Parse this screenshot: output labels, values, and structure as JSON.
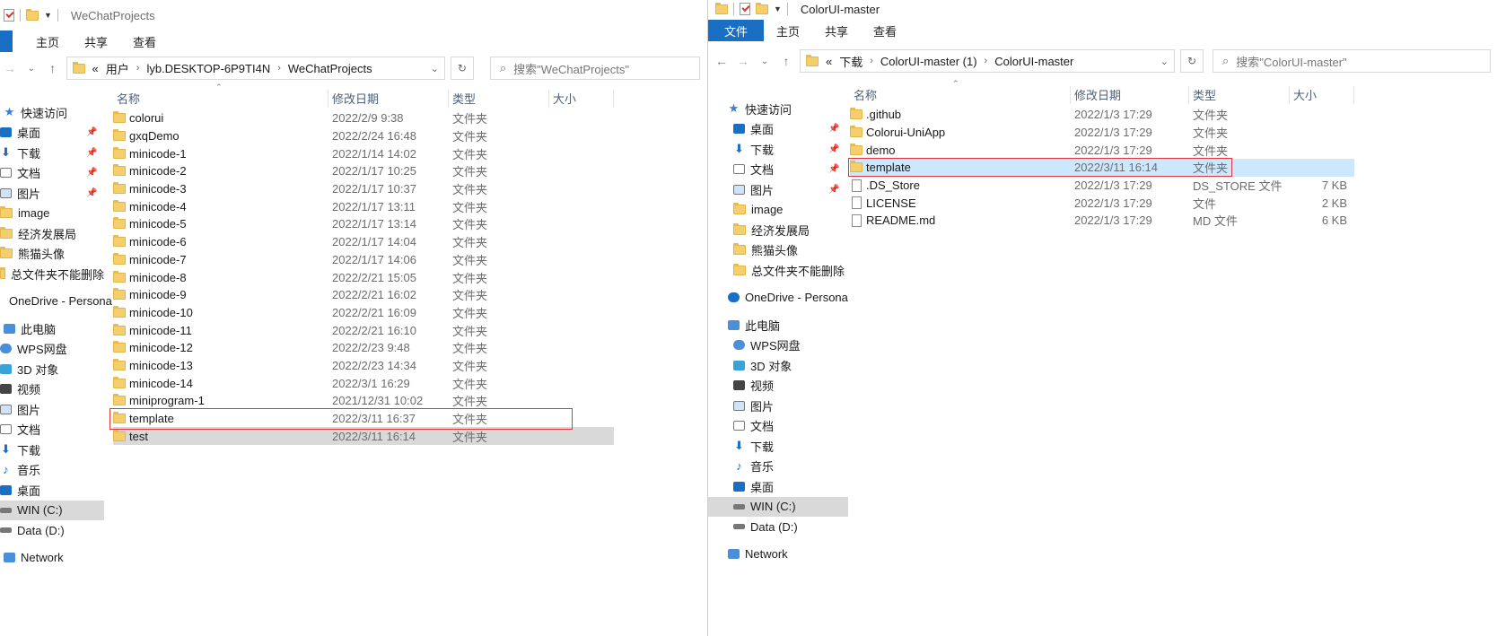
{
  "left": {
    "title": "WeChatProjects",
    "ribbon": {
      "home": "主页",
      "share": "共享",
      "view": "查看"
    },
    "breadcrumb": [
      "«",
      "用户",
      "lyb.DESKTOP-6P9TI4N",
      "WeChatProjects"
    ],
    "search_placeholder": "搜索\"WeChatProjects\"",
    "headers": {
      "name": "名称",
      "date": "修改日期",
      "type": "类型",
      "size": "大小"
    },
    "nav": [
      {
        "label": "快速访问",
        "icon": "star-icon"
      },
      {
        "label": "桌面",
        "icon": "desktop-icon",
        "pin": true
      },
      {
        "label": "下载",
        "icon": "download-icon",
        "pin": true
      },
      {
        "label": "文档",
        "icon": "document-icon",
        "pin": true
      },
      {
        "label": "图片",
        "icon": "picture-icon",
        "pin": true
      },
      {
        "label": "image",
        "icon": "folder-icon"
      },
      {
        "label": "经济发展局",
        "icon": "folder-icon"
      },
      {
        "label": "熊猫头像",
        "icon": "folder-icon"
      },
      {
        "label": "总文件夹不能删除",
        "icon": "folder-icon"
      },
      {
        "label": "OneDrive - Persona",
        "icon": "cloud-icon"
      },
      {
        "label": "此电脑",
        "icon": "computer-icon"
      },
      {
        "label": "WPS网盘",
        "icon": "wps-cloud-icon"
      },
      {
        "label": "3D 对象",
        "icon": "3d-objects-icon"
      },
      {
        "label": "视频",
        "icon": "video-icon"
      },
      {
        "label": "图片",
        "icon": "picture-icon"
      },
      {
        "label": "文档",
        "icon": "document-icon"
      },
      {
        "label": "下载",
        "icon": "download-icon"
      },
      {
        "label": "音乐",
        "icon": "music-icon"
      },
      {
        "label": "桌面",
        "icon": "desktop-icon"
      },
      {
        "label": "WIN (C:)",
        "icon": "drive-c-icon",
        "selected": true
      },
      {
        "label": "Data (D:)",
        "icon": "drive-d-icon"
      },
      {
        "label": "Network",
        "icon": "network-icon"
      }
    ],
    "files": [
      {
        "name": "colorui",
        "date": "2022/2/9 9:38",
        "type": "文件夹"
      },
      {
        "name": "gxqDemo",
        "date": "2022/2/24 16:48",
        "type": "文件夹"
      },
      {
        "name": "minicode-1",
        "date": "2022/1/14 14:02",
        "type": "文件夹"
      },
      {
        "name": "minicode-2",
        "date": "2022/1/17 10:25",
        "type": "文件夹"
      },
      {
        "name": "minicode-3",
        "date": "2022/1/17 10:37",
        "type": "文件夹"
      },
      {
        "name": "minicode-4",
        "date": "2022/1/17 13:11",
        "type": "文件夹"
      },
      {
        "name": "minicode-5",
        "date": "2022/1/17 13:14",
        "type": "文件夹"
      },
      {
        "name": "minicode-6",
        "date": "2022/1/17 14:04",
        "type": "文件夹"
      },
      {
        "name": "minicode-7",
        "date": "2022/1/17 14:06",
        "type": "文件夹"
      },
      {
        "name": "minicode-8",
        "date": "2022/2/21 15:05",
        "type": "文件夹"
      },
      {
        "name": "minicode-9",
        "date": "2022/2/21 16:02",
        "type": "文件夹"
      },
      {
        "name": "minicode-10",
        "date": "2022/2/21 16:09",
        "type": "文件夹"
      },
      {
        "name": "minicode-11",
        "date": "2022/2/21 16:10",
        "type": "文件夹"
      },
      {
        "name": "minicode-12",
        "date": "2022/2/23 9:48",
        "type": "文件夹"
      },
      {
        "name": "minicode-13",
        "date": "2022/2/23 14:34",
        "type": "文件夹"
      },
      {
        "name": "minicode-14",
        "date": "2022/3/1 16:29",
        "type": "文件夹"
      },
      {
        "name": "miniprogram-1",
        "date": "2021/12/31 10:02",
        "type": "文件夹"
      },
      {
        "name": "template",
        "date": "2022/3/11 16:37",
        "type": "文件夹",
        "boxed": true
      },
      {
        "name": "test",
        "date": "2022/3/11 16:14",
        "type": "文件夹",
        "grey": true
      }
    ]
  },
  "right": {
    "title": "ColorUI-master",
    "ribbon": {
      "file": "文件",
      "home": "主页",
      "share": "共享",
      "view": "查看"
    },
    "breadcrumb": [
      "«",
      "下载",
      "ColorUI-master (1)",
      "ColorUI-master"
    ],
    "search_placeholder": "搜索\"ColorUI-master\"",
    "headers": {
      "name": "名称",
      "date": "修改日期",
      "type": "类型",
      "size": "大小"
    },
    "nav": [
      {
        "label": "快速访问",
        "icon": "star-icon"
      },
      {
        "label": "桌面",
        "icon": "desktop-icon",
        "pin": true
      },
      {
        "label": "下载",
        "icon": "download-icon",
        "pin": true
      },
      {
        "label": "文档",
        "icon": "document-icon",
        "pin": true
      },
      {
        "label": "图片",
        "icon": "picture-icon",
        "pin": true
      },
      {
        "label": "image",
        "icon": "folder-icon"
      },
      {
        "label": "经济发展局",
        "icon": "folder-icon"
      },
      {
        "label": "熊猫头像",
        "icon": "folder-icon"
      },
      {
        "label": "总文件夹不能删除",
        "icon": "folder-icon"
      },
      {
        "label": "OneDrive - Persona",
        "icon": "cloud-icon"
      },
      {
        "label": "此电脑",
        "icon": "computer-icon"
      },
      {
        "label": "WPS网盘",
        "icon": "wps-cloud-icon"
      },
      {
        "label": "3D 对象",
        "icon": "3d-objects-icon"
      },
      {
        "label": "视频",
        "icon": "video-icon"
      },
      {
        "label": "图片",
        "icon": "picture-icon"
      },
      {
        "label": "文档",
        "icon": "document-icon"
      },
      {
        "label": "下载",
        "icon": "download-icon"
      },
      {
        "label": "音乐",
        "icon": "music-icon"
      },
      {
        "label": "桌面",
        "icon": "desktop-icon"
      },
      {
        "label": "WIN (C:)",
        "icon": "drive-c-icon",
        "selected": true
      },
      {
        "label": "Data (D:)",
        "icon": "drive-d-icon"
      },
      {
        "label": "Network",
        "icon": "network-icon"
      }
    ],
    "files": [
      {
        "name": ".github",
        "date": "2022/1/3 17:29",
        "type": "文件夹",
        "size": "",
        "kind": "folder"
      },
      {
        "name": "Colorui-UniApp",
        "date": "2022/1/3 17:29",
        "type": "文件夹",
        "size": "",
        "kind": "folder"
      },
      {
        "name": "demo",
        "date": "2022/1/3 17:29",
        "type": "文件夹",
        "size": "",
        "kind": "folder"
      },
      {
        "name": "template",
        "date": "2022/3/11 16:14",
        "type": "文件夹",
        "size": "",
        "kind": "folder",
        "selected": true
      },
      {
        "name": ".DS_Store",
        "date": "2022/1/3 17:29",
        "type": "DS_STORE 文件",
        "size": "7 KB",
        "kind": "file"
      },
      {
        "name": "LICENSE",
        "date": "2022/1/3 17:29",
        "type": "文件",
        "size": "2 KB",
        "kind": "file"
      },
      {
        "name": "README.md",
        "date": "2022/1/3 17:29",
        "type": "MD 文件",
        "size": "6 KB",
        "kind": "file"
      }
    ]
  },
  "colors": {
    "accent": "#1a6fc4",
    "selection": "#cce8ff",
    "highlight_box": "#e0353d",
    "folder": "#f5cf6b"
  }
}
